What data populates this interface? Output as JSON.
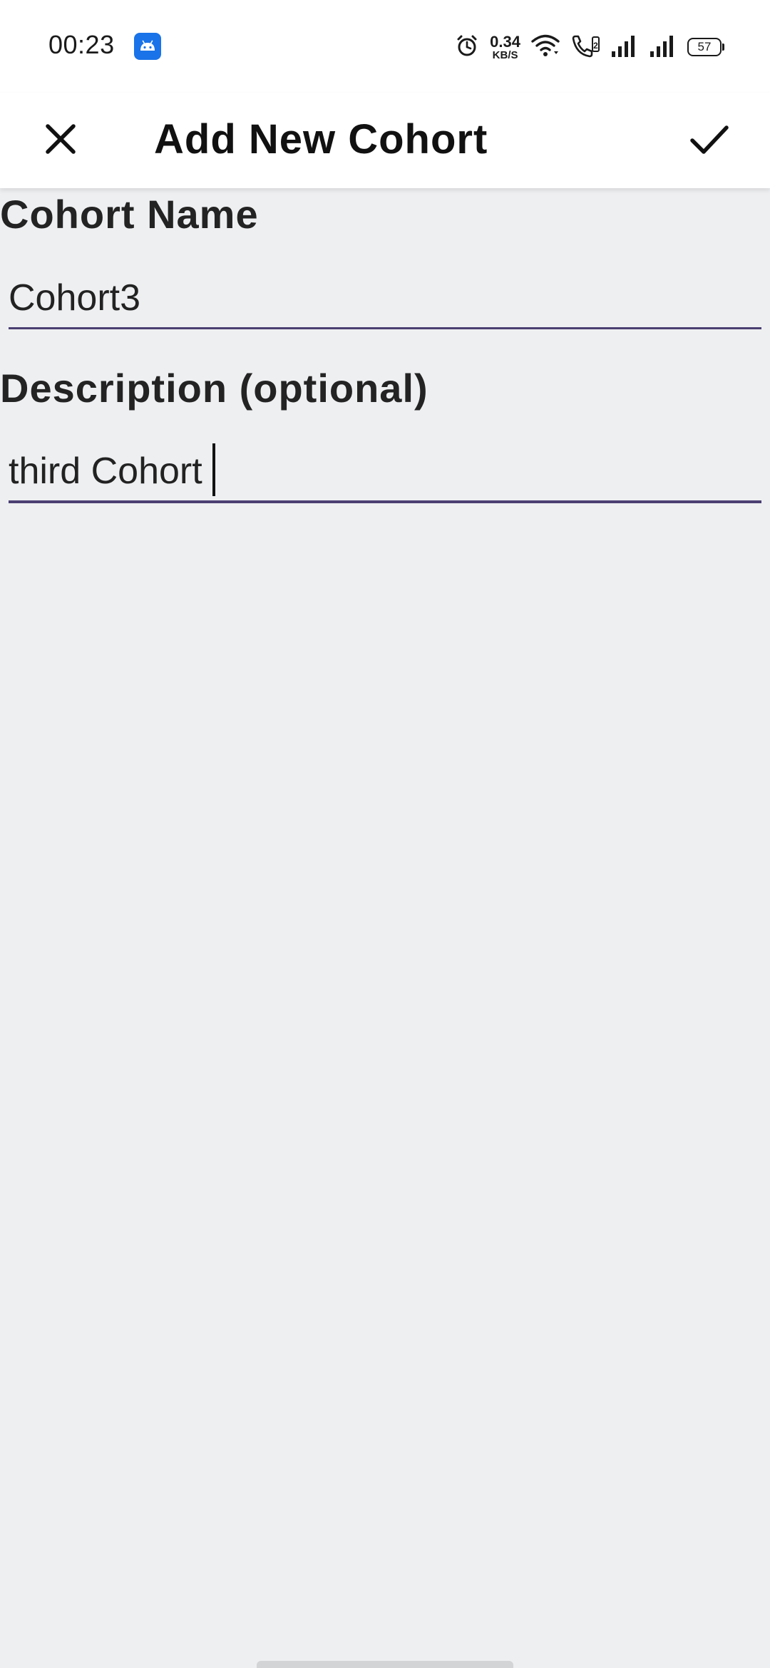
{
  "status_bar": {
    "time": "00:23",
    "net_speed_value": "0.34",
    "net_speed_unit": "KB/S",
    "battery": "57",
    "icons": [
      "android-notification-icon",
      "alarm-icon",
      "wifi-icon",
      "volte-call-icon",
      "signal-icon",
      "signal-icon",
      "battery-icon"
    ]
  },
  "app_bar": {
    "title": "Add New Cohort",
    "close_icon": "close-icon",
    "confirm_icon": "check-icon"
  },
  "form": {
    "name_label": "Cohort Name",
    "name_value": "Cohort3",
    "description_label": "Description (optional)",
    "description_value": "third Cohort"
  },
  "colors": {
    "accent": "#4b3f72",
    "background": "#eeeff1",
    "android_badge": "#1a73e8"
  }
}
